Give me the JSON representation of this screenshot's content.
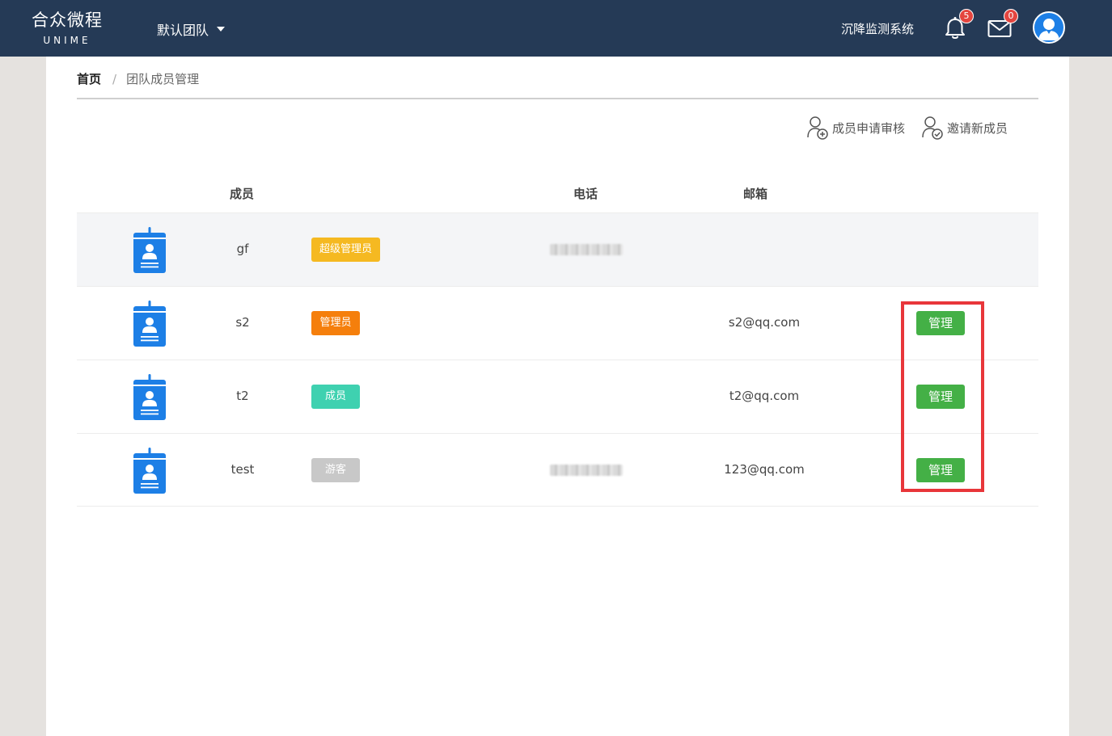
{
  "header": {
    "logo_cn": "合众微程",
    "logo_en": "UNIME",
    "team": "默认团队",
    "system": "沉降监测系统",
    "notifications_count": "5",
    "messages_count": "0"
  },
  "breadcrumb": {
    "home": "首页",
    "separator": "/",
    "current": "团队成员管理"
  },
  "actions": {
    "review": "成员申请审核",
    "invite": "邀请新成员"
  },
  "table": {
    "headers": {
      "member": "成员",
      "phone": "电话",
      "email": "邮箱"
    },
    "rows": [
      {
        "name": "gf",
        "role": "超级管理员",
        "role_color": "#f5b921",
        "email": "",
        "manage": ""
      },
      {
        "name": "s2",
        "role": "管理员",
        "role_color": "#f57f0c",
        "email": "s2@qq.com",
        "manage": "管理"
      },
      {
        "name": "t2",
        "role": "成员",
        "role_color": "#3fd1b0",
        "email": "t2@qq.com",
        "manage": "管理"
      },
      {
        "name": "test",
        "role": "游客",
        "role_color": "#c8c8c8",
        "email": "123@qq.com",
        "manage": "管理"
      }
    ]
  }
}
